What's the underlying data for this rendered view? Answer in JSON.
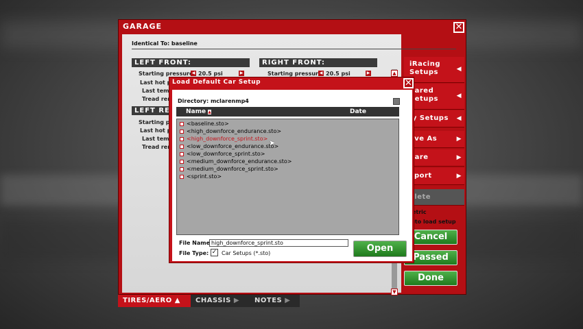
{
  "garage": {
    "title": "GARAGE",
    "identical_to": "Identical To: baseline",
    "left_front": {
      "title": "LEFT FRONT:",
      "rows": [
        "Starting pressure:",
        "Last hot pr",
        "Last temp",
        "Tread rem"
      ],
      "starting_pressure": "20.5 psi"
    },
    "right_front": {
      "title": "RIGHT FRONT:",
      "rows": [
        "Starting pressure:"
      ],
      "starting_pressure": "20.5 psi"
    },
    "left_rear": {
      "title": "LEFT RE",
      "rows": [
        "Starting pr",
        "Last hot pr",
        "Last temp",
        "Tread rem"
      ]
    },
    "side_menu": [
      {
        "label": "iRacing Setups"
      },
      {
        "label": "hared Setups"
      },
      {
        "label": "ly Setups"
      },
      {
        "label": "ave As"
      },
      {
        "label": "hare"
      },
      {
        "label": "xport"
      },
      {
        "label": "elete"
      }
    ],
    "metric_label": "Metric",
    "auto_load_label": "Auto load setup",
    "buttons": {
      "cancel": "Cancel",
      "passed": "Passed",
      "done": "Done"
    },
    "tabs": [
      {
        "label": "TIRES/AERO",
        "active": true
      },
      {
        "label": "CHASSIS",
        "active": false
      },
      {
        "label": "NOTES",
        "active": false
      }
    ]
  },
  "dialog": {
    "title": "Load Default Car Setup",
    "directory": "Directory: mclarenmp4",
    "col_name": "Name",
    "col_date": "Date",
    "files": [
      "<baseline.sto>",
      "<high_downforce_endurance.sto>",
      "<high_downforce_sprint.sto>",
      "<low_downforce_endurance.sto>",
      "<low_downforce_sprint.sto>",
      "<medium_downforce_endurance.sto>",
      "<medium_downforce_sprint.sto>",
      "<sprint.sto>"
    ],
    "selected_index": 2,
    "file_name_label": "File Name:",
    "file_name_value": "high_downforce_sprint.sto",
    "file_type_label": "File Type:",
    "file_type_value": "Car Setups (*.sto)",
    "open_label": "Open"
  },
  "colors": {
    "brand_red": "#c4121a",
    "green": "#2f8f2b"
  }
}
